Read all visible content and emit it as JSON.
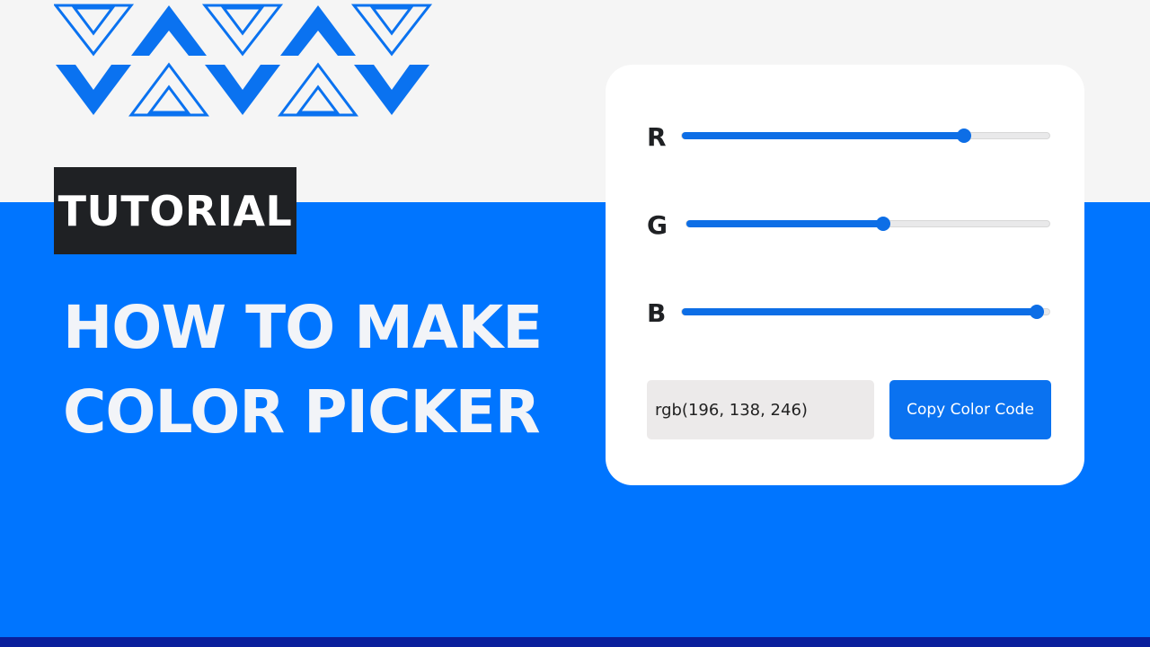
{
  "badge": {
    "text": "TUTORIAL"
  },
  "headline": {
    "line1": "HOW TO MAKE",
    "line2": "COLOR PICKER"
  },
  "picker": {
    "sliders": [
      {
        "label": "R",
        "value": 196,
        "max": 255
      },
      {
        "label": "G",
        "value": 138,
        "max": 255
      },
      {
        "label": "B",
        "value": 246,
        "max": 255
      }
    ],
    "color_code": "rgb(196, 138, 246)",
    "copy_label": "Copy Color Code"
  },
  "colors": {
    "accent": "#0075ff",
    "slider_fill": "#0d6ee6",
    "badge_bg": "#1f2124",
    "background": "#f5f5f5",
    "bottom_strip": "#0a1f9c"
  },
  "icons": {
    "pattern": "chevron-pattern-icon"
  }
}
